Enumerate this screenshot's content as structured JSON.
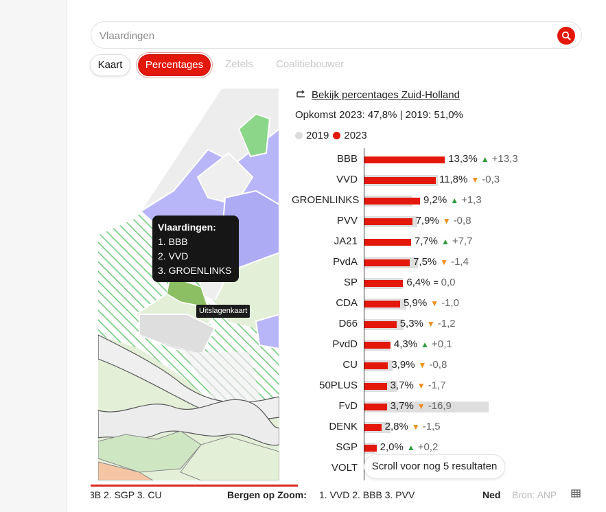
{
  "search": {
    "placeholder": "Vlaardingen"
  },
  "tabs": [
    {
      "label": "Kaart",
      "state": "default"
    },
    {
      "label": "Percentages",
      "state": "active"
    },
    {
      "label": "Zetels",
      "state": "disabled"
    },
    {
      "label": "Coalitiebouwer",
      "state": "disabled"
    }
  ],
  "map": {
    "tooltip": {
      "title": "Vlaardingen:",
      "lines": [
        "1. BBB",
        "2. VVD",
        "3. GROENLINKS"
      ]
    },
    "badge": "Uitslagenkaart"
  },
  "results": {
    "link_label": "Bekijk percentages Zuid-Holland",
    "turnout": "Opkomst 2023: 47,8% | 2019: 51,0%",
    "legend": [
      {
        "label": "2019",
        "color": "#dcdcdc"
      },
      {
        "label": "2023",
        "color": "#e3170a"
      }
    ],
    "scroll_hint": "Scroll voor nog 5 resultaten"
  },
  "chart_data": {
    "type": "bar",
    "orientation": "horizontal",
    "series": [
      {
        "name": "2019",
        "color": "#dedede"
      },
      {
        "name": "2023",
        "color": "#e3170a"
      }
    ],
    "rows": [
      {
        "party": "BBB",
        "pct2023": 13.3,
        "pct2019": 0.0,
        "pct_label": "13,3%",
        "trend": "up",
        "diff": "+13,3"
      },
      {
        "party": "VVD",
        "pct2023": 11.8,
        "pct2019": 12.1,
        "pct_label": "11,8%",
        "trend": "down",
        "diff": "-0,3"
      },
      {
        "party": "GROENLINKS",
        "pct2023": 9.2,
        "pct2019": 7.9,
        "pct_label": "9,2%",
        "trend": "up",
        "diff": "+1,3"
      },
      {
        "party": "PVV",
        "pct2023": 7.9,
        "pct2019": 8.7,
        "pct_label": "7,9%",
        "trend": "down",
        "diff": "-0,8"
      },
      {
        "party": "JA21",
        "pct2023": 7.7,
        "pct2019": 0.0,
        "pct_label": "7,7%",
        "trend": "up",
        "diff": "+7,7"
      },
      {
        "party": "PvdA",
        "pct2023": 7.5,
        "pct2019": 8.9,
        "pct_label": "7,5%",
        "trend": "down",
        "diff": "-1,4"
      },
      {
        "party": "SP",
        "pct2023": 6.4,
        "pct2019": 6.4,
        "pct_label": "6,4%",
        "trend": "equal",
        "diff": "0,0"
      },
      {
        "party": "CDA",
        "pct2023": 5.9,
        "pct2019": 6.9,
        "pct_label": "5,9%",
        "trend": "down",
        "diff": "-1,0"
      },
      {
        "party": "D66",
        "pct2023": 5.3,
        "pct2019": 6.5,
        "pct_label": "5,3%",
        "trend": "down",
        "diff": "-1,2"
      },
      {
        "party": "PvdD",
        "pct2023": 4.3,
        "pct2019": 4.2,
        "pct_label": "4,3%",
        "trend": "up",
        "diff": "+0,1"
      },
      {
        "party": "CU",
        "pct2023": 3.9,
        "pct2019": 4.7,
        "pct_label": "3,9%",
        "trend": "down",
        "diff": "-0,8"
      },
      {
        "party": "50PLUS",
        "pct2023": 3.7,
        "pct2019": 5.4,
        "pct_label": "3,7%",
        "trend": "down",
        "diff": "-1,7"
      },
      {
        "party": "FvD",
        "pct2023": 3.7,
        "pct2019": 20.6,
        "pct_label": "3,7%",
        "trend": "down",
        "diff": "-16,9"
      },
      {
        "party": "DENK",
        "pct2023": 2.8,
        "pct2019": 4.3,
        "pct_label": "2,8%",
        "trend": "down",
        "diff": "-1,5"
      },
      {
        "party": "SGP",
        "pct2023": 2.0,
        "pct2019": 1.8,
        "pct_label": "2,0%",
        "trend": "up",
        "diff": "+0,2"
      },
      {
        "party": "VOLT",
        "pct2023": null,
        "pct2019": null,
        "pct_label": "",
        "trend": "",
        "diff": ""
      }
    ],
    "xlim": [
      0,
      21
    ]
  },
  "ticker": {
    "lead": "3B  2. SGP  3. CU",
    "place": "Bergen op Zoom:",
    "ranks": "1. VVD  2. BBB  3. PVV",
    "cut": "Ned"
  },
  "footer": {
    "source": "Bron: ANP",
    "table_icon": "table-icon"
  },
  "colors": {
    "accent": "#e3170a",
    "up": "#2e9a3a",
    "down": "#f08d1b",
    "map_purple": "#b8b6f8",
    "map_green": "#8cd68a",
    "map_land": "#e4efd8"
  }
}
